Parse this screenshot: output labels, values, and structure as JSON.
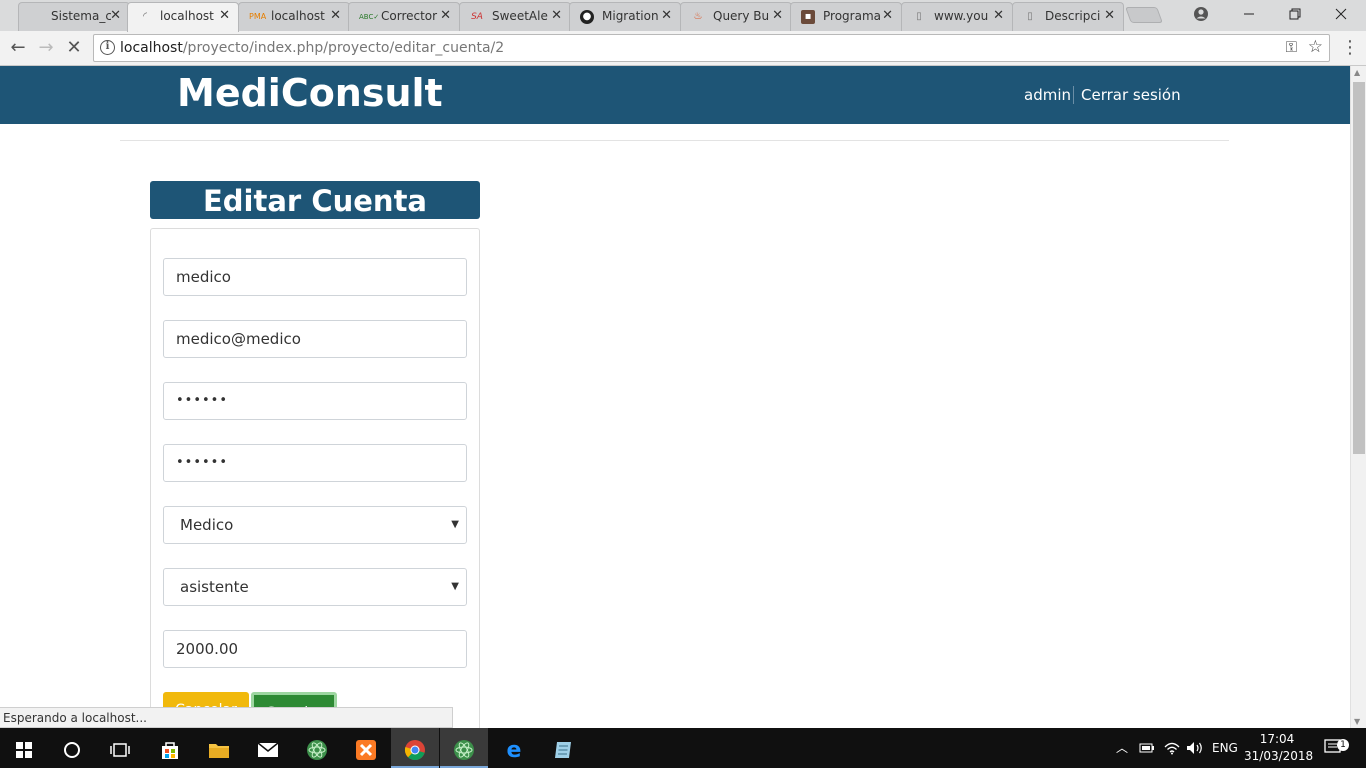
{
  "browser": {
    "tabs": [
      {
        "title": "Sistema_c",
        "icon": "blank-icon",
        "active": false
      },
      {
        "title": "localhost",
        "icon": "loading-icon",
        "active": true
      },
      {
        "title": "localhost",
        "icon": "phpmyadmin-icon",
        "active": false
      },
      {
        "title": "Corrector",
        "icon": "abc-icon",
        "active": false
      },
      {
        "title": "SweetAle",
        "icon": "sweetalert-icon",
        "active": false
      },
      {
        "title": "Migration",
        "icon": "github-icon",
        "active": false
      },
      {
        "title": "Query Bu",
        "icon": "codeigniter-icon",
        "active": false
      },
      {
        "title": "Programa",
        "icon": "contact-icon",
        "active": false
      },
      {
        "title": "www.you",
        "icon": "page-icon",
        "active": false
      },
      {
        "title": "Descripci",
        "icon": "page-icon",
        "active": false
      }
    ],
    "close_glyph": "✕",
    "url_host": "localhost",
    "url_path": "/proyecto/index.php/proyecto/editar_cuenta/2",
    "status_text": "Esperando a localhost..."
  },
  "app": {
    "brand": "MediConsult",
    "user": "admin",
    "logout": "Cerrar sesión",
    "accent_color": "#1e5576"
  },
  "form": {
    "title": "Editar Cuenta",
    "username": "medico",
    "email": "medico@medico",
    "password": "••••••",
    "password_confirm": "••••••",
    "role": "Medico",
    "assistant": "asistente",
    "amount": "2000.00",
    "cancel_label": "Cancelar",
    "save_label": "Guardar"
  },
  "taskbar": {
    "language": "ENG",
    "time": "17:04",
    "date": "31/03/2018",
    "notifications": "1"
  }
}
